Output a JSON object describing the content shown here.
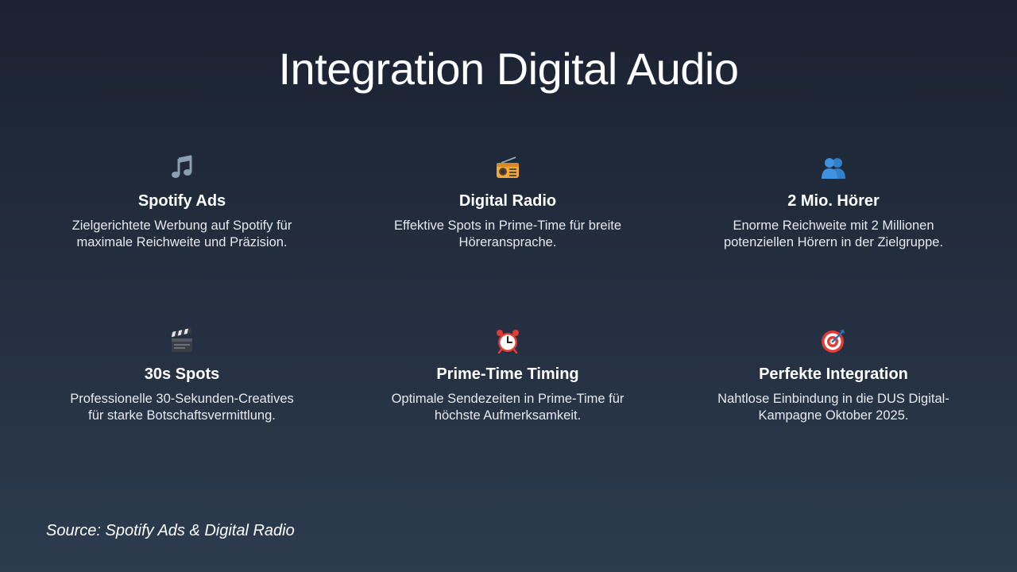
{
  "slide": {
    "title": "Integration Digital Audio",
    "source": "Source: Spotify Ads & Digital Radio"
  },
  "cards": [
    {
      "icon": "music-note-icon",
      "title": "Spotify Ads",
      "description": "Zielgerichtete Werbung auf Spotify für maximale Reichweite und Präzision."
    },
    {
      "icon": "radio-icon",
      "title": "Digital Radio",
      "description": "Effektive Spots in Prime-Time für breite Höreransprache."
    },
    {
      "icon": "people-icon",
      "title": "2 Mio. Hörer",
      "description": "Enorme Reichweite mit 2 Millionen potenziellen Hörern in der Zielgruppe."
    },
    {
      "icon": "clapperboard-icon",
      "title": "30s Spots",
      "description": "Professionelle 30-Sekunden-Creatives für starke Botschaftsvermittlung."
    },
    {
      "icon": "alarm-clock-icon",
      "title": "Prime-Time Timing",
      "description": "Optimale Sendezeiten in Prime-Time für höchste Aufmerksamkeit."
    },
    {
      "icon": "target-icon",
      "title": "Perfekte Integration",
      "description": "Nahtlose Einbindung in die DUS Digital-Kampagne Oktober 2025."
    }
  ],
  "colors": {
    "background_top": "#1b2232",
    "background_bottom": "#2c3b4e",
    "text": "#ffffff"
  }
}
